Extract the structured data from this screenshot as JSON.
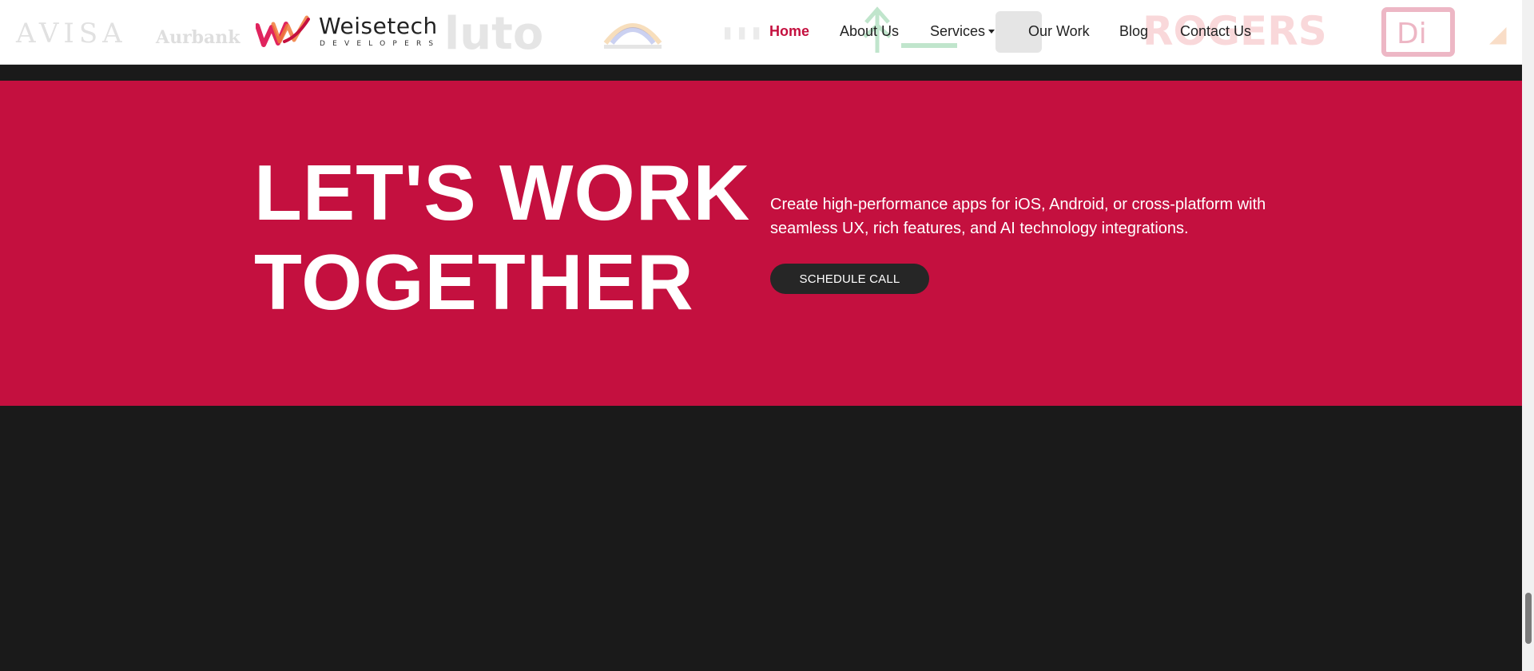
{
  "header": {
    "logo_strip": [
      "AVISA",
      "Aurbank",
      "luto",
      "ROGERS",
      "Di"
    ],
    "brand": {
      "name": "Weisetech",
      "tagline": "DEVELOPERS",
      "accent": "#e0245e"
    },
    "nav": [
      {
        "label": "Home",
        "active": true
      },
      {
        "label": "About Us",
        "active": false
      },
      {
        "label": "Services",
        "active": false,
        "has_dropdown": true
      },
      {
        "label": "Our Work",
        "active": false
      },
      {
        "label": "Blog",
        "active": false
      },
      {
        "label": "Contact Us",
        "active": false
      }
    ]
  },
  "cta": {
    "title_line1": "LET'S WORK",
    "title_line2": "TOGETHER",
    "description": "Create high-performance apps for iOS, Android, or cross-platform with seamless UX, rich features, and AI technology integrations.",
    "button_label": "SCHEDULE CALL",
    "background": "#c4103f",
    "button_color": "#262626"
  },
  "footer": {
    "background": "#1a1a1a"
  }
}
